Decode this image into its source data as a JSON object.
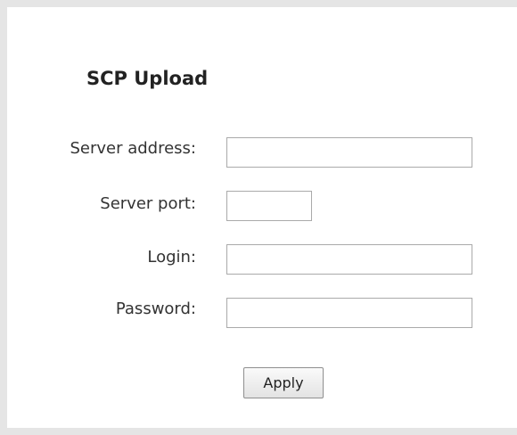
{
  "panel": {
    "title": "SCP Upload"
  },
  "form": {
    "server_address": {
      "label": "Server address:",
      "value": "",
      "placeholder": ""
    },
    "server_port": {
      "label": "Server port:",
      "value": "",
      "placeholder": ""
    },
    "login": {
      "label": "Login:",
      "value": "",
      "placeholder": ""
    },
    "password": {
      "label": "Password:",
      "value": "",
      "placeholder": ""
    }
  },
  "actions": {
    "apply_label": "Apply"
  }
}
